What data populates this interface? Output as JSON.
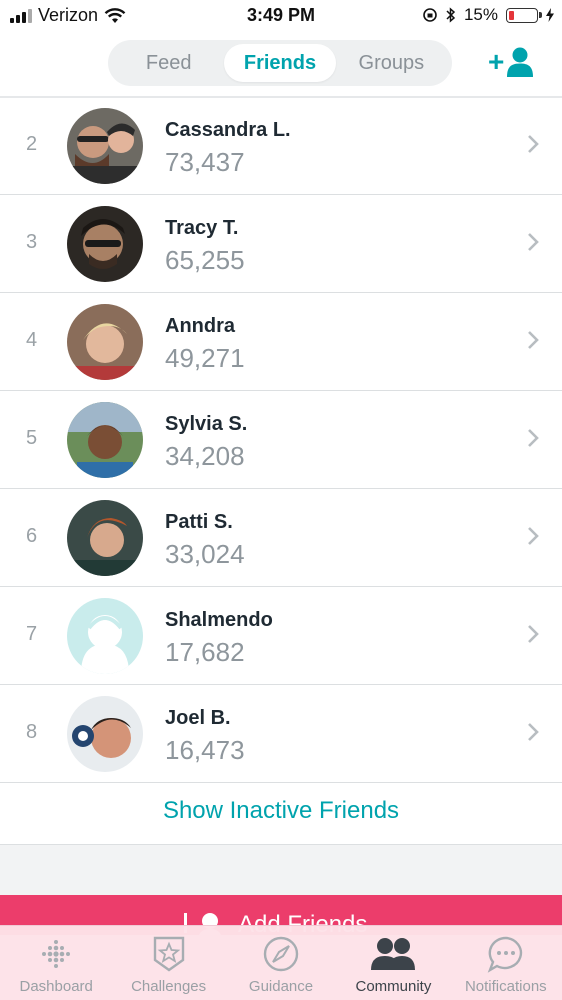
{
  "status_bar": {
    "carrier": "Verizon",
    "time": "3:49 PM",
    "battery_percent": "15%",
    "battery_level": 0.15,
    "colors": {
      "battery_low": "#e4353a"
    }
  },
  "header": {
    "tabs": [
      {
        "label": "Feed",
        "active": false
      },
      {
        "label": "Friends",
        "active": true
      },
      {
        "label": "Groups",
        "active": false
      }
    ],
    "add_friend_icon": "add-user-icon",
    "colors": {
      "accent": "#00a3ad"
    }
  },
  "leaderboard": [
    {
      "rank": "2",
      "name": "Cassandra L.",
      "steps": "73,437"
    },
    {
      "rank": "3",
      "name": "Tracy T.",
      "steps": "65,255"
    },
    {
      "rank": "4",
      "name": "Anndra",
      "steps": "49,271"
    },
    {
      "rank": "5",
      "name": "Sylvia S.",
      "steps": "34,208"
    },
    {
      "rank": "6",
      "name": "Patti S.",
      "steps": "33,024"
    },
    {
      "rank": "7",
      "name": "Shalmendo",
      "steps": "17,682"
    },
    {
      "rank": "8",
      "name": "Joel B.",
      "steps": "16,473"
    }
  ],
  "show_inactive_label": "Show Inactive Friends",
  "add_friends_label": "Add Friends",
  "tab_bar": [
    {
      "label": "Dashboard",
      "icon": "dashboard-dots-icon",
      "active": false
    },
    {
      "label": "Challenges",
      "icon": "star-badge-icon",
      "active": false
    },
    {
      "label": "Guidance",
      "icon": "compass-icon",
      "active": false
    },
    {
      "label": "Community",
      "icon": "people-icon",
      "active": true
    },
    {
      "label": "Notifications",
      "icon": "chat-bubble-icon",
      "active": false
    }
  ],
  "colors": {
    "accent": "#00a3ad",
    "add_friends_bar": "#ec3d6b",
    "tab_bar_bg": "#fde2e8"
  }
}
